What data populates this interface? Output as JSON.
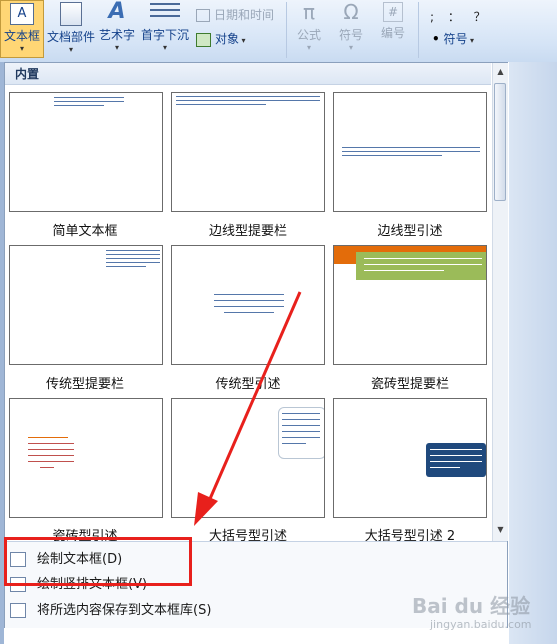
{
  "ribbon": {
    "textbox_label": "文本框",
    "docparts_label": "文档部件",
    "wordart_label": "艺术字",
    "dropcap_label": "首字下沉",
    "datetime_label": "日期和时间",
    "object_label": "对象",
    "formula_label": "公式",
    "symbol_label": "符号",
    "numbering_label": "编号",
    "symbol2_label": "符号",
    "punct_sample": "; ： ？",
    "numbering_icon_text": "#",
    "textbox_icon_text": "A",
    "formula_icon_text": "π",
    "symbol_icon_text": "Ω"
  },
  "gallery": {
    "header": "内置",
    "tiles": [
      {
        "name": "简单文本框"
      },
      {
        "name": "边线型提要栏"
      },
      {
        "name": "边线型引述"
      },
      {
        "name": "传统型提要栏"
      },
      {
        "name": "传统型引述"
      },
      {
        "name": "瓷砖型提要栏"
      },
      {
        "name": "瓷砖型引述"
      },
      {
        "name": "大括号型引述"
      },
      {
        "name": "大括号型引述 2"
      }
    ]
  },
  "commands": {
    "draw_textbox": "绘制文本框(D)",
    "draw_vertical": "绘制竖排文本框(V)",
    "save_selection": "将所选内容保存到文本框库(S)"
  },
  "watermark": {
    "brand": "Bai du 经验",
    "url": "jingyan.baidu.com"
  },
  "colors": {
    "annotation_red": "#e8201c",
    "tile_orange": "#e36c0a",
    "tile_green": "#9bbb59",
    "tile_blue": "#1f497d"
  }
}
